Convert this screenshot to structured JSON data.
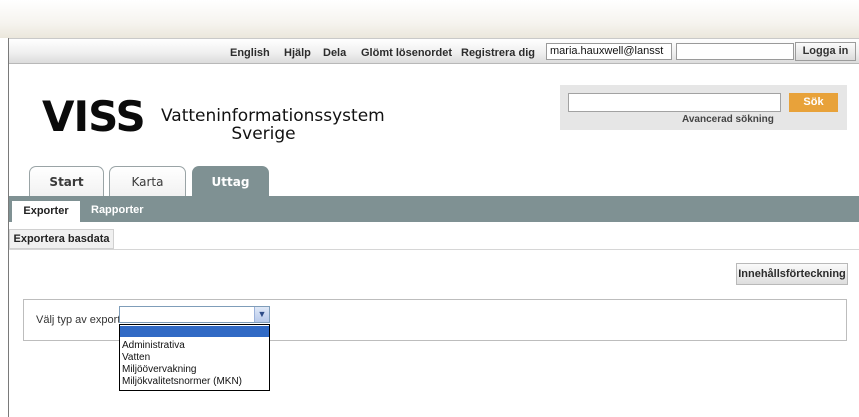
{
  "utility_bar": {
    "links": [
      "English",
      "Hjälp",
      "Dela",
      "Glömt lösenordet",
      "Registrera dig"
    ],
    "username_value": "maria.hauxwell@lansst",
    "password_value": "",
    "login_label": "Logga in"
  },
  "logo": {
    "title": "VISS",
    "subtitle_line1": "Vatteninformationssystem",
    "subtitle_line2": "Sverige"
  },
  "search": {
    "value": "",
    "button_label": "Sök",
    "advanced_label": "Avancerad sökning",
    "button_color": "#e8a23a"
  },
  "tabs": [
    {
      "label": "Start",
      "active": false
    },
    {
      "label": "Karta",
      "active": false
    },
    {
      "label": "Uttag",
      "active": true
    }
  ],
  "subnav": {
    "items": [
      {
        "label": "Exporter",
        "active": true
      },
      {
        "label": "Rapporter",
        "active": false
      }
    ],
    "color": "#7f9193"
  },
  "section_tab": {
    "label": "Exportera basdata"
  },
  "toc_button": {
    "label": "Innehållsförteckning"
  },
  "export": {
    "label": "Välj typ av export:",
    "selected_value": "",
    "options": [
      "",
      "Administrativa",
      "Vatten",
      "Miljöövervakning",
      "Miljökvalitetsnormer (MKN)"
    ],
    "highlight_color": "#316ac5"
  }
}
